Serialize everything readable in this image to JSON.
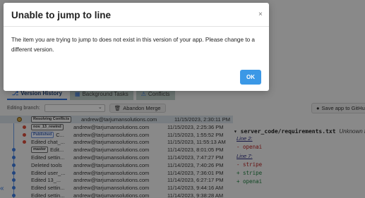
{
  "modal": {
    "title": "Unable to jump to line",
    "close": "×",
    "message": "The item you are trying to jump to does not exist in this version of your app. Please change to a different version.",
    "ok_label": "OK"
  },
  "tabs": [
    {
      "label": "Version History",
      "icon": "branch-icon"
    },
    {
      "label": "Background Tasks",
      "icon": "tasks-icon"
    },
    {
      "label": "Conflicts",
      "icon": "conflict-icon"
    }
  ],
  "branchbar": {
    "label": "Editing branch:",
    "abandon_label": "Abandon Merge"
  },
  "save_label": "Save app to GitHub",
  "history": [
    {
      "badge": "Resolving Conflicts",
      "badge_kind": "conflict",
      "msg": "",
      "author": "andrew@tarjumansolutions.com",
      "date": "11/15/2023, 2:30:11 PM",
      "highlight": true
    },
    {
      "badge": "nov_13_rewind",
      "badge_kind": "tag",
      "msg": "",
      "author": "andrew@tarjumansolutions.com",
      "date": "11/15/2023, 2:25:36 PM"
    },
    {
      "badge": "Published",
      "badge_kind": "pub",
      "msg": "C...",
      "author": "andrew@tarjumansolutions.com",
      "date": "11/15/2023, 1:55:52 PM"
    },
    {
      "badge": "",
      "msg": "Edited chat_...",
      "author": "andrew@tarjumansolutions.com",
      "date": "11/15/2023, 11:55:13 AM"
    },
    {
      "badge": "master",
      "badge_kind": "tag",
      "msg": "Edit...",
      "author": "andrew@tarjumansolutions.com",
      "date": "11/14/2023, 8:01:05 PM"
    },
    {
      "badge": "",
      "msg": "Edited settin...",
      "author": "andrew@tarjumansolutions.com",
      "date": "11/14/2023, 7:47:27 PM"
    },
    {
      "badge": "",
      "msg": "Deleted tools",
      "author": "andrew@tarjumansolutions.com",
      "date": "11/14/2023, 7:40:26 PM"
    },
    {
      "badge": "",
      "msg": "Edited user_...",
      "author": "andrew@tarjumansolutions.com",
      "date": "11/14/2023, 7:36:01 PM"
    },
    {
      "badge": "",
      "msg": "Edited 13_...",
      "author": "andrew@tarjumansolutions.com",
      "date": "11/14/2023, 6:27:17 PM"
    },
    {
      "badge": "",
      "msg": "Edited settin...",
      "author": "andrew@tarjumansolutions.com",
      "date": "11/14/2023, 9:44:16 AM"
    },
    {
      "badge": "",
      "msg": "Edited settin...",
      "author": "andrew@tarjumansolutions.com",
      "date": "11/14/2023, 9:38:28 AM"
    }
  ],
  "file": {
    "name": "server_code/requirements.txt",
    "status": "Unknown file",
    "lines": [
      {
        "kind": "hdr",
        "text": "Line 2:"
      },
      {
        "kind": "rm",
        "text": "- openai"
      },
      {
        "kind": "hdr",
        "text": "Line 7:"
      },
      {
        "kind": "rm",
        "text": "- stripe"
      },
      {
        "kind": "add",
        "text": "+ stripe"
      },
      {
        "kind": "add",
        "text": "+ openai"
      }
    ]
  },
  "colors": {
    "accent": "#3b98e6",
    "graph_blue": "#3b78d8",
    "graph_red": "#d24a3a"
  }
}
